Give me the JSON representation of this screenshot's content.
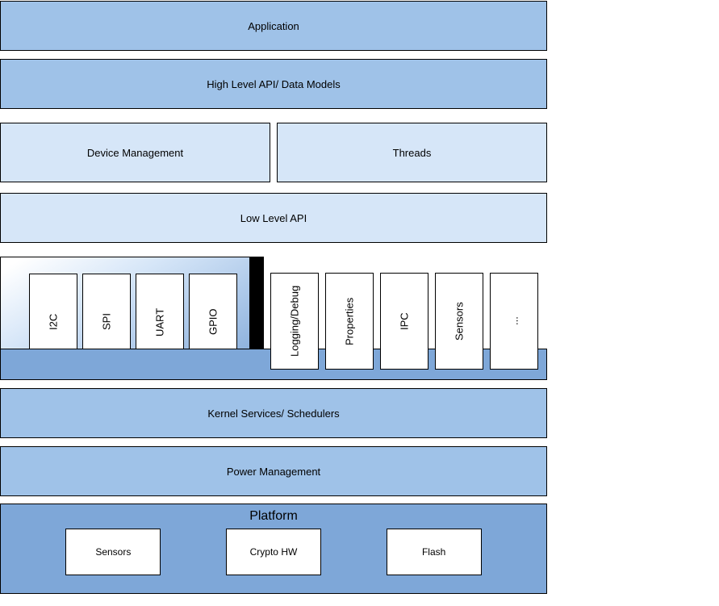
{
  "layers": {
    "application": "Application",
    "high_level_api": "High Level API/ Data Models",
    "device_mgmt": "Device Management",
    "threads": "Threads",
    "low_level_api": "Low Level API",
    "kernel": "Kernel Services/ Schedulers",
    "power": "Power Management",
    "platform": "Platform"
  },
  "drivers": {
    "items": [
      "I2C",
      "SPI",
      "UART",
      "GPIO"
    ]
  },
  "services": {
    "items": [
      "Logging/Debug",
      "Properties",
      "IPC",
      "Sensors",
      "..."
    ]
  },
  "platform_items": [
    "Sensors",
    "Crypto HW",
    "Flash"
  ]
}
